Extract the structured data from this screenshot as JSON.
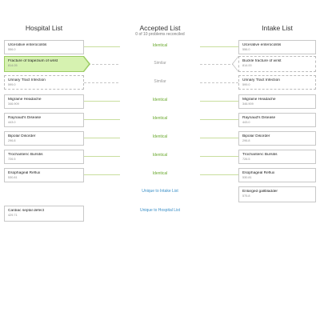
{
  "columns": {
    "hospital_title": "Hospital List",
    "accepted_title": "Accepted List",
    "accepted_subtitle": "0 of 10 problems reconciled",
    "intake_title": "Intake List"
  },
  "rows": [
    {
      "left": {
        "name": "Ulcerative enterocolitis",
        "code": "556.0"
      },
      "right": {
        "name": "Ulcerative enterocolitis",
        "code": "556.0"
      },
      "match": "Identical"
    },
    {
      "left": {
        "name": "Fracture of trapezium of wrist",
        "code": "814.05"
      },
      "right": {
        "name": "Buckle fracture of wrist",
        "code": "814.00"
      },
      "match": "Similar"
    },
    {
      "left": {
        "name": "Urinary Tract Infection",
        "code": "599.0"
      },
      "right": {
        "name": "Urinary Tract Infection",
        "code": "599.0"
      },
      "match": "Similar"
    },
    {
      "left": {
        "name": "Migraine Headache",
        "code": "346.909"
      },
      "right": {
        "name": "Migraine Headache",
        "code": "346.909"
      },
      "match": "Identical"
    },
    {
      "left": {
        "name": "Raynaud's Disease",
        "code": "443.0"
      },
      "right": {
        "name": "Raynaud's Disease",
        "code": "443.0"
      },
      "match": "Identical"
    },
    {
      "left": {
        "name": "Bipolar Disorder",
        "code": "296.8"
      },
      "right": {
        "name": "Bipolar Disorder",
        "code": "296.8"
      },
      "match": "Identical"
    },
    {
      "left": {
        "name": "Trochanteric Bursitis",
        "code": "726.5"
      },
      "right": {
        "name": "Trochanteric Bursitis",
        "code": "726.5"
      },
      "match": "Identical"
    },
    {
      "left": {
        "name": "Esophageal Reflux",
        "code": "530.81"
      },
      "right": {
        "name": "Esophageal Reflux",
        "code": "530.81"
      },
      "match": "Identical"
    }
  ],
  "unique_intake": {
    "label": "Unique to Intake List",
    "name": "Enlarged gallbladder",
    "code": "575.8"
  },
  "unique_hospital": {
    "label": "Unique to Hospital List",
    "name": "Cardiac septal defect",
    "code": "429.71"
  },
  "colors": {
    "identical": "#6aa92e",
    "selected_bg": "#d6f2b0",
    "link": "#3a8fc7"
  }
}
